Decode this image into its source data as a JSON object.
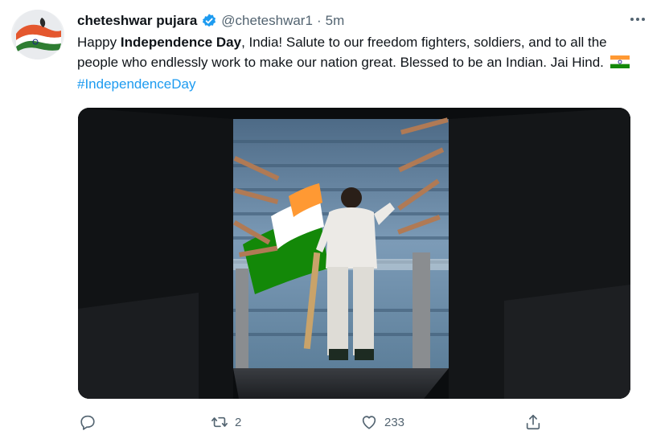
{
  "tweet": {
    "author_name": "cheteshwar pujara",
    "handle": "@cheteshwar1",
    "separator": "·",
    "time": "5m",
    "text_part1": "Happy ",
    "text_bold1": "Independence Day",
    "text_part2": ", India! Salute to our freedom fighters, soldiers, and to all the people who endlessly work to make our nation great. Blessed to be an Indian. Jai Hind. ",
    "hashtag": "#IndependenceDay"
  },
  "actions": {
    "reply_count": "",
    "retweet_count": "2",
    "like_count": "233"
  },
  "icons": {
    "verified": "verified-badge-icon",
    "more": "more-dots-icon",
    "reply": "reply-icon",
    "retweet": "retweet-icon",
    "like": "heart-icon",
    "share": "share-icon",
    "flag": "india-flag-emoji"
  },
  "colors": {
    "accent": "#1d9bf0",
    "secondary_text": "#536471",
    "flag_saffron": "#ff9933",
    "flag_green": "#138808"
  }
}
